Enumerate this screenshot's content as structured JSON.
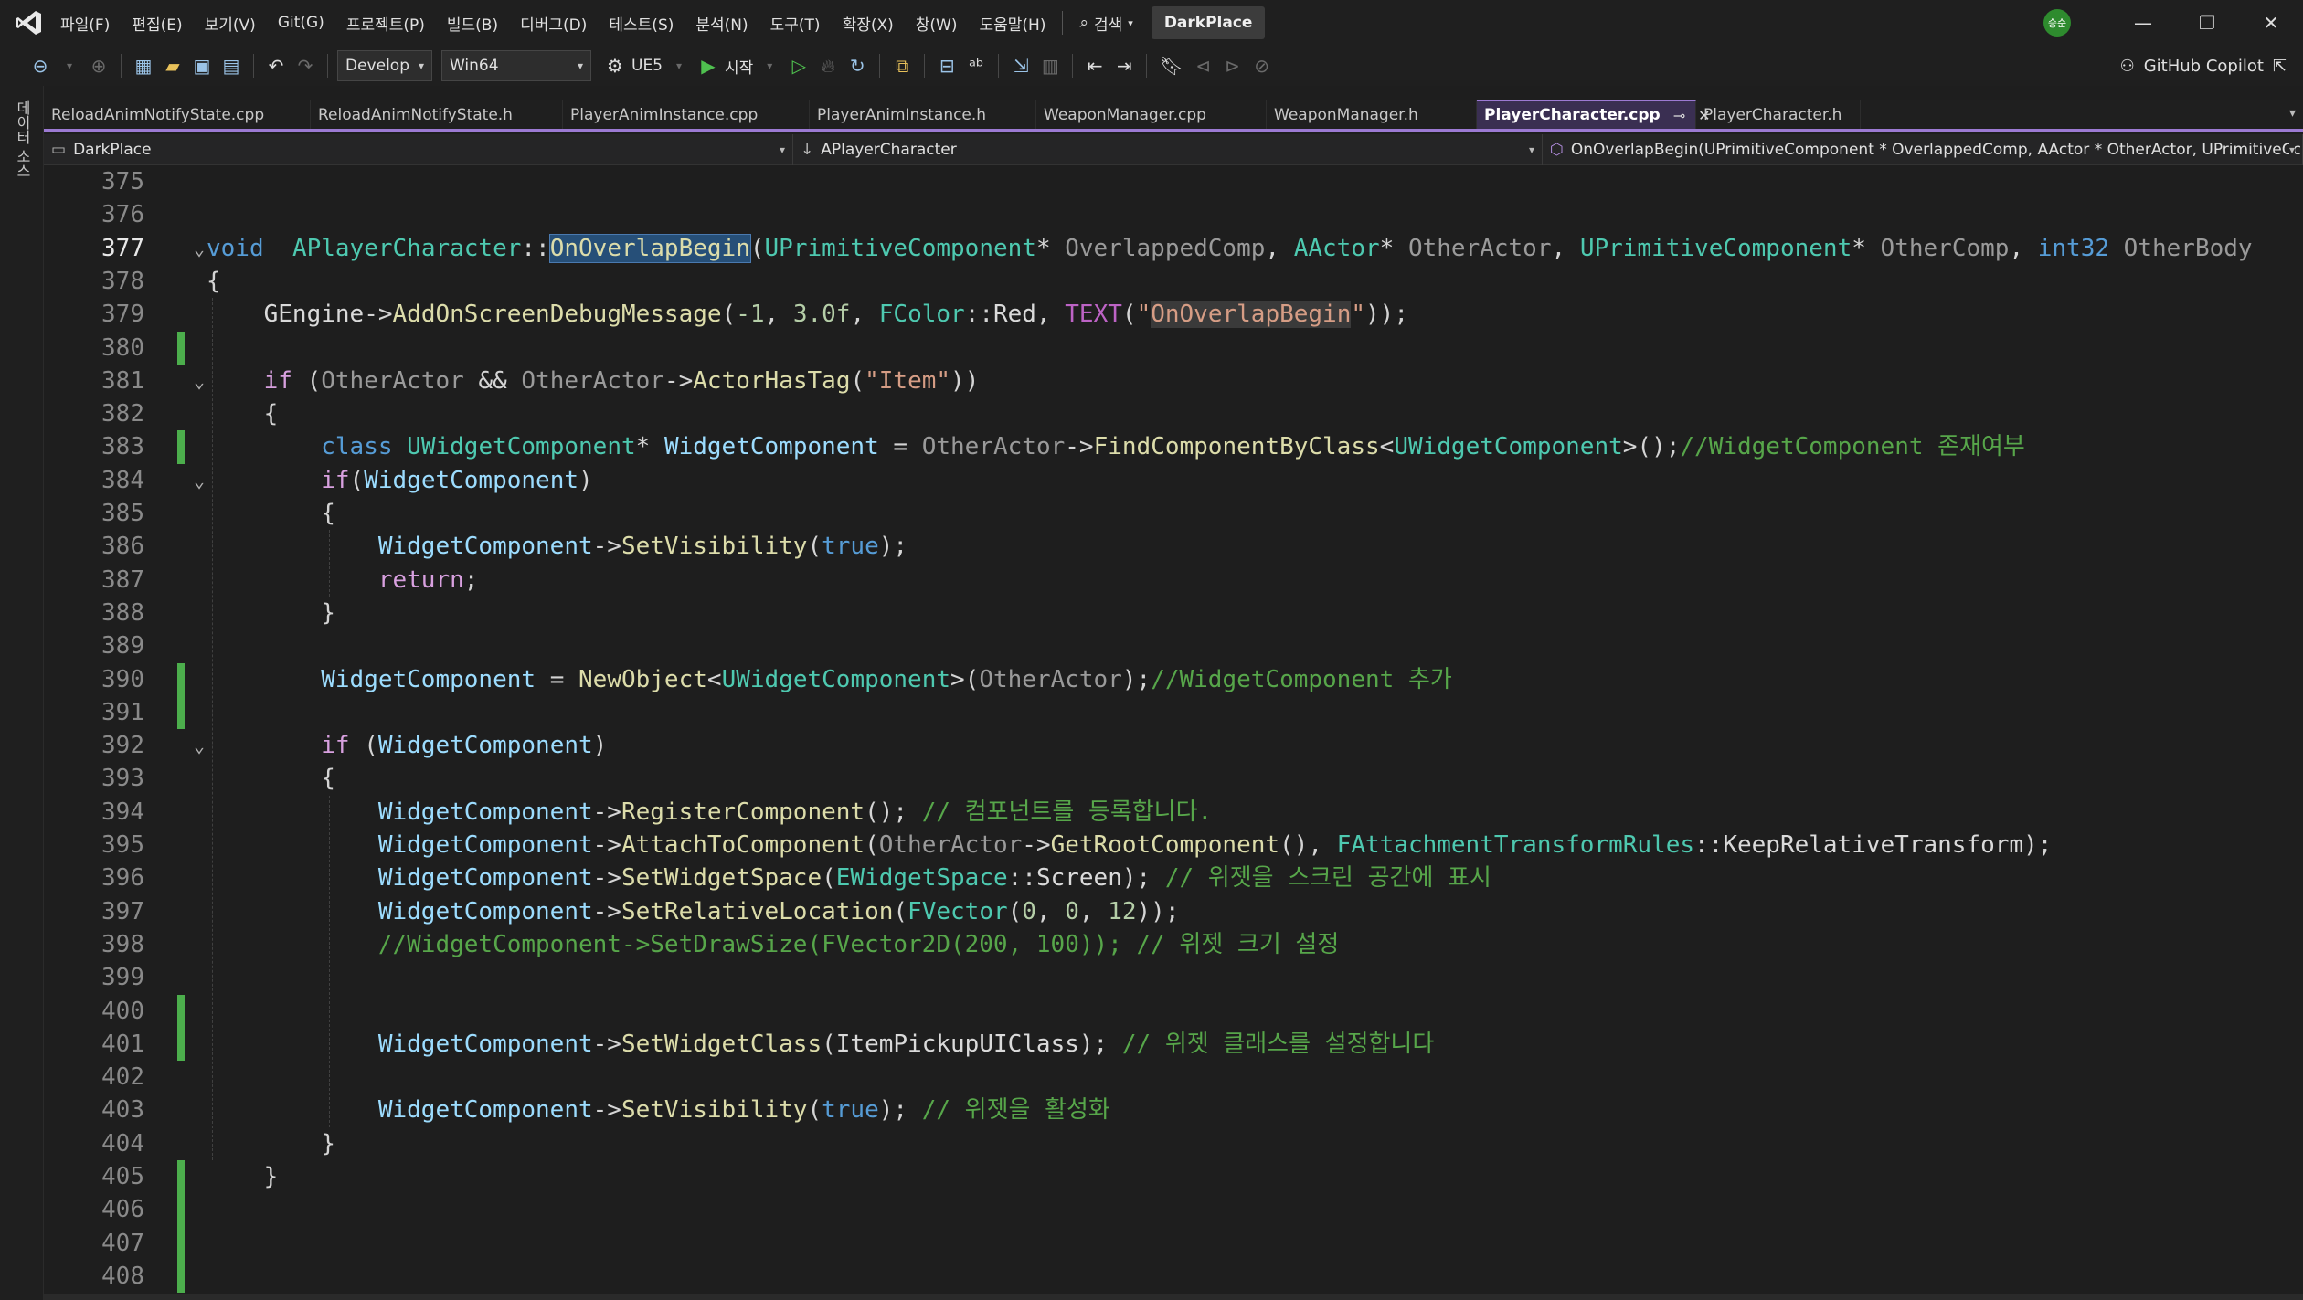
{
  "menu": {
    "items": [
      "파일(F)",
      "편집(E)",
      "보기(V)",
      "Git(G)",
      "프로젝트(P)",
      "빌드(B)",
      "디버그(D)",
      "테스트(S)",
      "분석(N)",
      "도구(T)",
      "확장(X)",
      "창(W)",
      "도움말(H)"
    ],
    "search_label": "검색",
    "solution_name": "DarkPlace",
    "avatar_text": "승순"
  },
  "toolbar": {
    "configuration": "Develop",
    "platform": "Win64",
    "ue_label": "UE5",
    "start_label": "시작",
    "copilot_label": "GitHub Copilot"
  },
  "side_strip": {
    "label": "데이터 소스"
  },
  "tabs": [
    {
      "label": "ReloadAnimNotifyState.cpp",
      "active": false
    },
    {
      "label": "ReloadAnimNotifyState.h",
      "active": false
    },
    {
      "label": "PlayerAnimInstance.cpp",
      "active": false
    },
    {
      "label": "PlayerAnimInstance.h",
      "active": false
    },
    {
      "label": "WeaponManager.cpp",
      "active": false
    },
    {
      "label": "WeaponManager.h",
      "active": false
    },
    {
      "label": "PlayerCharacter.cpp",
      "active": true
    },
    {
      "label": "PlayerCharacter.h",
      "active": false
    }
  ],
  "navbar": {
    "project": "DarkPlace",
    "scope": "APlayerCharacter",
    "member": "OnOverlapBegin(UPrimitiveComponent * OverlappedComp, AActor * OtherActor, UPrimitiveCc"
  },
  "editor": {
    "current_line": 377,
    "lines": [
      {
        "n": 375,
        "mod": false,
        "fold": "",
        "tokens": []
      },
      {
        "n": 376,
        "mod": false,
        "fold": "",
        "tokens": []
      },
      {
        "n": 377,
        "mod": false,
        "fold": "v",
        "tokens": [
          [
            "kw",
            "void"
          ],
          [
            "",
            "  "
          ],
          [
            "ty",
            "APlayerCharacter"
          ],
          [
            "",
            "::"
          ],
          [
            "fn sel",
            "OnOverlapBegin"
          ],
          [
            "",
            "("
          ],
          [
            "ty",
            "UPrimitiveComponent"
          ],
          [
            "",
            "* "
          ],
          [
            "param",
            "OverlappedComp"
          ],
          [
            "",
            ", "
          ],
          [
            "ty",
            "AActor"
          ],
          [
            "",
            "* "
          ],
          [
            "param",
            "OtherActor"
          ],
          [
            "",
            ", "
          ],
          [
            "ty",
            "UPrimitiveComponent"
          ],
          [
            "",
            "* "
          ],
          [
            "param",
            "OtherComp"
          ],
          [
            "",
            ", "
          ],
          [
            "kw",
            "int32"
          ],
          [
            "param",
            " OtherBody"
          ]
        ]
      },
      {
        "n": 378,
        "mod": false,
        "fold": "",
        "tokens": [
          [
            "",
            "{"
          ]
        ]
      },
      {
        "n": 379,
        "mod": false,
        "fold": "",
        "tokens": [
          [
            "",
            "    "
          ],
          [
            "ident",
            "GEngine"
          ],
          [
            "",
            "->"
          ],
          [
            "fn",
            "AddOnScreenDebugMessage"
          ],
          [
            "",
            "("
          ],
          [
            "num",
            "-1"
          ],
          [
            "",
            ", "
          ],
          [
            "num",
            "3.0f"
          ],
          [
            "",
            ", "
          ],
          [
            "ty",
            "FColor"
          ],
          [
            "",
            "::"
          ],
          [
            "ident",
            "Red"
          ],
          [
            "",
            ", "
          ],
          [
            "macro",
            "TEXT"
          ],
          [
            "",
            "("
          ],
          [
            "str",
            "\""
          ],
          [
            "str strhl",
            "OnOverlapBegin"
          ],
          [
            "str",
            "\""
          ],
          [
            "",
            "));"
          ]
        ]
      },
      {
        "n": 380,
        "mod": true,
        "fold": "",
        "tokens": []
      },
      {
        "n": 381,
        "mod": false,
        "fold": "v",
        "tokens": [
          [
            "",
            "    "
          ],
          [
            "ctl",
            "if"
          ],
          [
            "",
            " ("
          ],
          [
            "param",
            "OtherActor"
          ],
          [
            "",
            " && "
          ],
          [
            "param",
            "OtherActor"
          ],
          [
            "",
            "->"
          ],
          [
            "fn",
            "ActorHasTag"
          ],
          [
            "",
            "("
          ],
          [
            "str",
            "\"Item\""
          ],
          [
            "",
            "))"
          ]
        ]
      },
      {
        "n": 382,
        "mod": false,
        "fold": "",
        "tokens": [
          [
            "",
            "    {"
          ]
        ]
      },
      {
        "n": 383,
        "mod": true,
        "fold": "",
        "tokens": [
          [
            "",
            "        "
          ],
          [
            "kw",
            "class"
          ],
          [
            "",
            " "
          ],
          [
            "ty",
            "UWidgetComponent"
          ],
          [
            "",
            "* "
          ],
          [
            "var",
            "WidgetComponent"
          ],
          [
            "",
            " = "
          ],
          [
            "param",
            "OtherActor"
          ],
          [
            "",
            "->"
          ],
          [
            "fn",
            "FindComponentByClass"
          ],
          [
            "",
            "<"
          ],
          [
            "ty",
            "UWidgetComponent"
          ],
          [
            "",
            ">();"
          ],
          [
            "cm",
            "//WidgetComponent 존재여부"
          ]
        ]
      },
      {
        "n": 384,
        "mod": false,
        "fold": "v",
        "tokens": [
          [
            "",
            "        "
          ],
          [
            "ctl",
            "if"
          ],
          [
            "",
            "",
            " "
          ],
          [
            "",
            "("
          ],
          [
            "var",
            "WidgetComponent"
          ],
          [
            "",
            ")"
          ]
        ]
      },
      {
        "n": 385,
        "mod": false,
        "fold": "",
        "tokens": [
          [
            "",
            "        {"
          ]
        ]
      },
      {
        "n": 386,
        "mod": false,
        "fold": "",
        "tokens": [
          [
            "",
            "            "
          ],
          [
            "var",
            "WidgetComponent"
          ],
          [
            "",
            "->"
          ],
          [
            "fn",
            "SetVisibility"
          ],
          [
            "",
            "("
          ],
          [
            "kw",
            "true"
          ],
          [
            "",
            ");"
          ]
        ]
      },
      {
        "n": 387,
        "mod": false,
        "fold": "",
        "tokens": [
          [
            "",
            "            "
          ],
          [
            "ctl",
            "return"
          ],
          [
            "",
            ";"
          ]
        ]
      },
      {
        "n": 388,
        "mod": false,
        "fold": "",
        "tokens": [
          [
            "",
            "        }"
          ]
        ]
      },
      {
        "n": 389,
        "mod": false,
        "fold": "",
        "tokens": []
      },
      {
        "n": 390,
        "mod": true,
        "fold": "",
        "tokens": [
          [
            "",
            "        "
          ],
          [
            "var",
            "WidgetComponent"
          ],
          [
            "",
            " = "
          ],
          [
            "fn",
            "NewObject"
          ],
          [
            "",
            "<"
          ],
          [
            "ty",
            "UWidgetComponent"
          ],
          [
            "",
            ">("
          ],
          [
            "param",
            "OtherActor"
          ],
          [
            "",
            ");"
          ],
          [
            "cm",
            "//WidgetComponent 추가"
          ]
        ]
      },
      {
        "n": 391,
        "mod": true,
        "fold": "",
        "tokens": []
      },
      {
        "n": 392,
        "mod": false,
        "fold": "v",
        "tokens": [
          [
            "",
            "        "
          ],
          [
            "ctl",
            "if"
          ],
          [
            "",
            " ("
          ],
          [
            "var",
            "WidgetComponent"
          ],
          [
            "",
            ")"
          ]
        ]
      },
      {
        "n": 393,
        "mod": false,
        "fold": "",
        "tokens": [
          [
            "",
            "        {"
          ]
        ]
      },
      {
        "n": 394,
        "mod": false,
        "fold": "",
        "tokens": [
          [
            "",
            "            "
          ],
          [
            "var",
            "WidgetComponent"
          ],
          [
            "",
            "->"
          ],
          [
            "fn",
            "RegisterComponent"
          ],
          [
            "",
            "(); "
          ],
          [
            "cm",
            "// 컴포넌트를 등록합니다."
          ]
        ]
      },
      {
        "n": 395,
        "mod": false,
        "fold": "",
        "tokens": [
          [
            "",
            "            "
          ],
          [
            "var",
            "WidgetComponent"
          ],
          [
            "",
            "->"
          ],
          [
            "fn",
            "AttachToComponent"
          ],
          [
            "",
            "("
          ],
          [
            "param",
            "OtherActor"
          ],
          [
            "",
            "->"
          ],
          [
            "fn",
            "GetRootComponent"
          ],
          [
            "",
            "(), "
          ],
          [
            "ty",
            "FAttachmentTransformRules"
          ],
          [
            "",
            "::"
          ],
          [
            "ident",
            "KeepRelativeTransform"
          ],
          [
            "",
            ");"
          ]
        ]
      },
      {
        "n": 396,
        "mod": false,
        "fold": "",
        "tokens": [
          [
            "",
            "            "
          ],
          [
            "var",
            "WidgetComponent"
          ],
          [
            "",
            "->"
          ],
          [
            "fn",
            "SetWidgetSpace"
          ],
          [
            "",
            "("
          ],
          [
            "ty",
            "EWidgetSpace"
          ],
          [
            "",
            "::"
          ],
          [
            "ident",
            "Screen"
          ],
          [
            "",
            "); "
          ],
          [
            "cm",
            "// 위젯을 스크린 공간에 표시"
          ]
        ]
      },
      {
        "n": 397,
        "mod": false,
        "fold": "",
        "tokens": [
          [
            "",
            "            "
          ],
          [
            "var",
            "WidgetComponent"
          ],
          [
            "",
            "->"
          ],
          [
            "fn",
            "SetRelativeLocation"
          ],
          [
            "",
            "("
          ],
          [
            "ty",
            "FVector"
          ],
          [
            "",
            "("
          ],
          [
            "num",
            "0"
          ],
          [
            "",
            ", "
          ],
          [
            "num",
            "0"
          ],
          [
            "",
            ", "
          ],
          [
            "num",
            "12"
          ],
          [
            "",
            "));"
          ]
        ]
      },
      {
        "n": 398,
        "mod": false,
        "fold": "",
        "tokens": [
          [
            "",
            "            "
          ],
          [
            "cm",
            "//WidgetComponent->SetDrawSize(FVector2D(200, 100)); // 위젯 크기 설정"
          ]
        ]
      },
      {
        "n": 399,
        "mod": false,
        "fold": "",
        "tokens": []
      },
      {
        "n": 400,
        "mod": true,
        "fold": "",
        "tokens": []
      },
      {
        "n": 401,
        "mod": true,
        "fold": "",
        "tokens": [
          [
            "",
            "            "
          ],
          [
            "var",
            "WidgetComponent"
          ],
          [
            "",
            "->"
          ],
          [
            "fn",
            "SetWidgetClass"
          ],
          [
            "",
            "("
          ],
          [
            "ident",
            "ItemPickupUIClass"
          ],
          [
            "",
            "); "
          ],
          [
            "cm",
            "// 위젯 클래스를 설정합니다"
          ]
        ]
      },
      {
        "n": 402,
        "mod": false,
        "fold": "",
        "tokens": []
      },
      {
        "n": 403,
        "mod": false,
        "fold": "",
        "tokens": [
          [
            "",
            "            "
          ],
          [
            "var",
            "WidgetComponent"
          ],
          [
            "",
            "->"
          ],
          [
            "fn",
            "SetVisibility"
          ],
          [
            "",
            "("
          ],
          [
            "kw",
            "true"
          ],
          [
            "",
            "); "
          ],
          [
            "cm",
            "// 위젯을 활성화"
          ]
        ]
      },
      {
        "n": 404,
        "mod": false,
        "fold": "",
        "tokens": [
          [
            "",
            "        }"
          ]
        ]
      },
      {
        "n": 405,
        "mod": true,
        "fold": "",
        "tokens": [
          [
            "",
            "    }"
          ]
        ]
      },
      {
        "n": 406,
        "mod": true,
        "fold": "",
        "tokens": []
      },
      {
        "n": 407,
        "mod": true,
        "fold": "",
        "tokens": []
      },
      {
        "n": 408,
        "mod": true,
        "fold": "",
        "tokens": []
      }
    ]
  }
}
